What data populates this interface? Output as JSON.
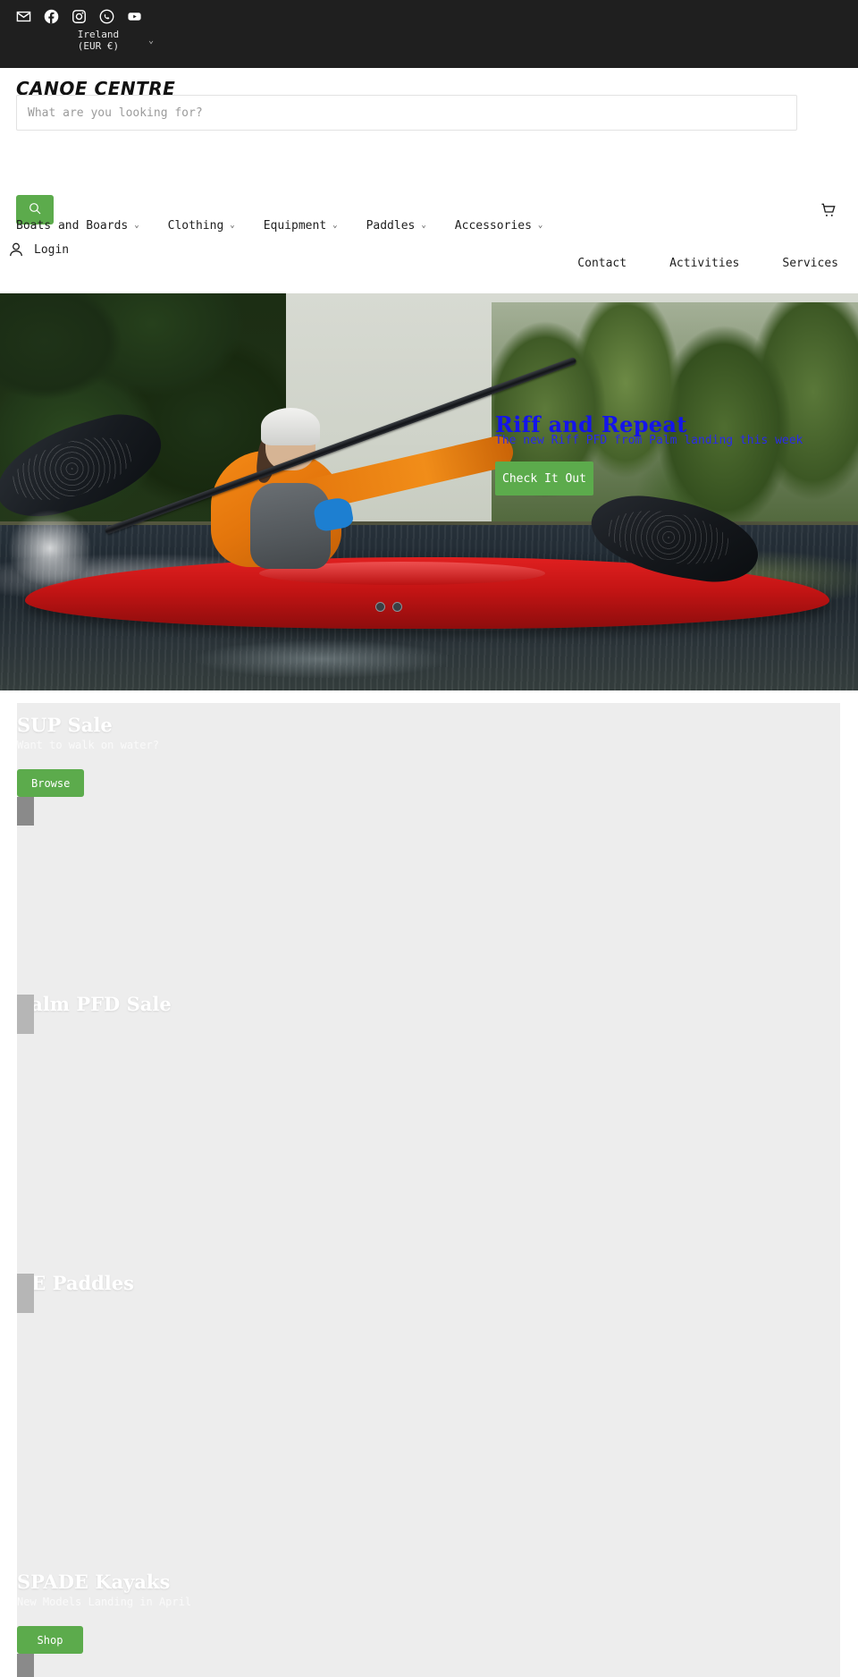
{
  "topbar": {
    "social": [
      {
        "name": "email-icon",
        "label": "Email"
      },
      {
        "name": "facebook-icon",
        "label": "Facebook"
      },
      {
        "name": "instagram-icon",
        "label": "Instagram"
      },
      {
        "name": "whatsapp-icon",
        "label": "WhatsApp"
      },
      {
        "name": "youtube-icon",
        "label": "YouTube"
      }
    ],
    "locale": {
      "value": "Ireland\n(EUR €)",
      "line1": "Ireland",
      "line2": "(EUR €)",
      "chevron": "⌄"
    }
  },
  "header": {
    "brand": "CANOE CENTRE",
    "search": {
      "placeholder": "What are you looking for?",
      "value": "",
      "button_icon": "search-icon"
    },
    "cart_icon": "cart-icon",
    "account": {
      "icon": "user-icon",
      "label": "Login"
    }
  },
  "nav_primary": [
    {
      "label": "Boats and Boards",
      "chevron": "⌄"
    },
    {
      "label": "Clothing",
      "chevron": "⌄"
    },
    {
      "label": "Equipment",
      "chevron": "⌄"
    },
    {
      "label": "Paddles",
      "chevron": "⌄"
    },
    {
      "label": "Accessories",
      "chevron": "⌄"
    }
  ],
  "nav_secondary": [
    {
      "label": "Contact"
    },
    {
      "label": "Activities"
    },
    {
      "label": "Services"
    }
  ],
  "hero": {
    "title": "Riff and Repeat",
    "subtitle": "The new Riff PFD from Palm landing this week",
    "cta_label": "Check It Out",
    "title_color": "#1414ec",
    "cta_color": "#5cab4c"
  },
  "promos": [
    {
      "id": "sup",
      "title": "SUP Sale",
      "subtitle": "Want to walk on water?",
      "cta_label": "Browse"
    },
    {
      "id": "palm",
      "title": "Palm PFD Sale",
      "subtitle": "",
      "cta_label": ""
    },
    {
      "id": "ve",
      "title": "VE Paddles",
      "subtitle": "",
      "cta_label": ""
    },
    {
      "id": "spade",
      "title": "SPADE Kayaks",
      "subtitle": "New Models Landing in April",
      "cta_label": "Shop"
    }
  ],
  "colors": {
    "accent_green": "#5cab4c",
    "topbar_bg": "#1f1f1f",
    "promo_bg": "#ededed",
    "hero_link_blue": "#1414ec"
  }
}
